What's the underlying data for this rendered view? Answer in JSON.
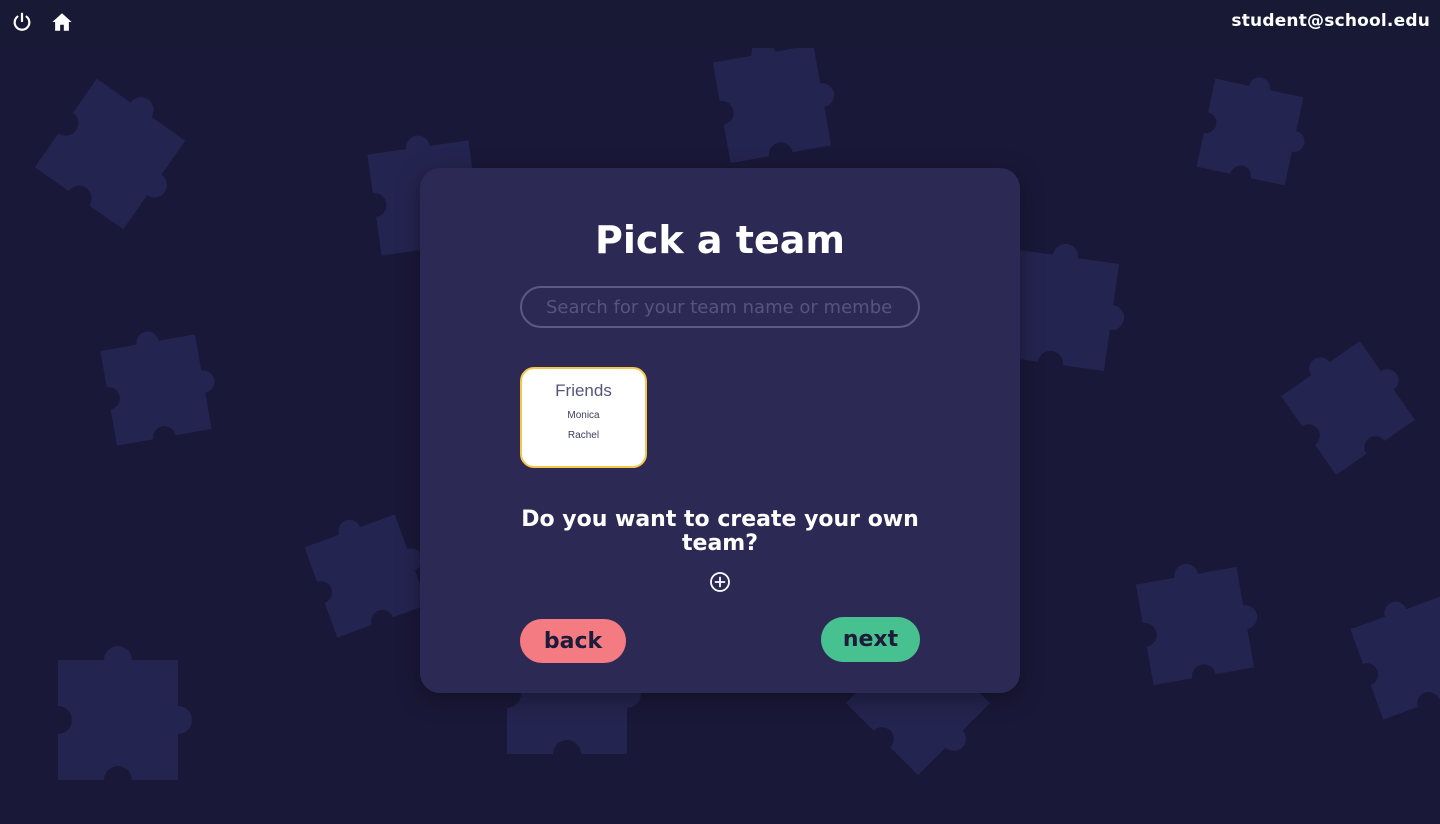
{
  "topbar": {
    "power_icon": "power-icon",
    "home_icon": "home-icon",
    "user_email": "student@school.edu"
  },
  "background": {
    "pattern_icon": "puzzle-piece-icon",
    "piece_color": "#242450"
  },
  "card": {
    "title": "Pick a team",
    "search": {
      "placeholder": "Search for your team name or members",
      "value": ""
    },
    "teams": [
      {
        "name": "Friends",
        "members": [
          "Monica",
          "Rachel"
        ]
      }
    ],
    "create_prompt": "Do you want to create your own team?",
    "add_icon": "circle-plus-icon",
    "back_label": "back",
    "next_label": "next"
  },
  "colors": {
    "background": "#1a1838",
    "card": "#2c2a54",
    "selected_border": "#f4c64a",
    "back": "#f47b82",
    "next": "#47c18f"
  }
}
